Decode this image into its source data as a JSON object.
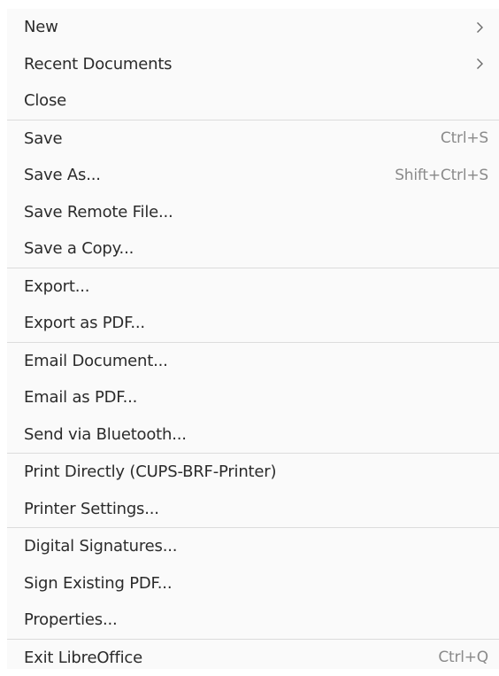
{
  "menu": {
    "groups": [
      {
        "items": [
          {
            "label": "New",
            "submenu": true
          },
          {
            "label": "Recent Documents",
            "submenu": true
          },
          {
            "label": "Close"
          }
        ]
      },
      {
        "items": [
          {
            "label": "Save",
            "accel": "Ctrl+S"
          },
          {
            "label": "Save As...",
            "accel": "Shift+Ctrl+S"
          },
          {
            "label": "Save Remote File..."
          },
          {
            "label": "Save a Copy..."
          }
        ]
      },
      {
        "items": [
          {
            "label": "Export..."
          },
          {
            "label": "Export as PDF..."
          }
        ]
      },
      {
        "items": [
          {
            "label": "Email Document..."
          },
          {
            "label": "Email as PDF..."
          },
          {
            "label": "Send via Bluetooth..."
          }
        ]
      },
      {
        "items": [
          {
            "label": "Print Directly (CUPS-BRF-Printer)"
          },
          {
            "label": "Printer Settings..."
          }
        ]
      },
      {
        "items": [
          {
            "label": "Digital Signatures..."
          },
          {
            "label": "Sign Existing PDF..."
          },
          {
            "label": "Properties..."
          }
        ]
      },
      {
        "items": [
          {
            "label": "Exit LibreOffice",
            "accel": "Ctrl+Q"
          }
        ]
      }
    ],
    "icons": {
      "submenu": "chevron-right-icon"
    }
  }
}
